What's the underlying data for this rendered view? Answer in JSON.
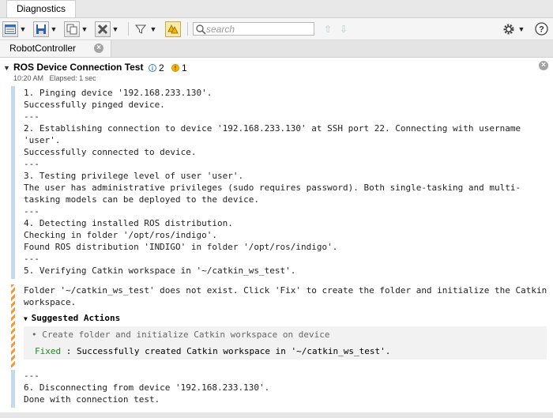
{
  "window": {
    "main_tab": "Diagnostics"
  },
  "toolbar": {
    "search_placeholder": "search",
    "icons": [
      "view-list-icon",
      "save-icon",
      "copy-icon",
      "clear-icon",
      "filter-icon",
      "warning-filter-icon",
      "up-arrow-icon",
      "down-arrow-icon",
      "gear-icon",
      "help-icon"
    ]
  },
  "sub_tab": {
    "label": "RobotController"
  },
  "section": {
    "title": "ROS Device Connection Test",
    "info_count": "2",
    "warning_count": "1",
    "time": "10:20 AM",
    "elapsed": "Elapsed: 1 sec"
  },
  "log": {
    "block1": [
      "1. Pinging device '192.168.233.130'.",
      "Successfully pinged device.",
      "---",
      "2. Establishing connection to device '192.168.233.130' at SSH port 22. Connecting with username",
      "'user'.",
      "Successfully connected to device.",
      "---",
      "3. Testing privilege level of user 'user'.",
      "The user has administrative privileges (sudo requires password). Both single-tasking and multi-",
      "tasking models can be deployed to the device.",
      "---",
      "4. Detecting installed ROS distribution.",
      "Checking in folder '/opt/ros/indigo'.",
      "Found ROS distribution 'INDIGO' in folder '/opt/ros/indigo'.",
      "---",
      "5. Verifying Catkin workspace in '~/catkin_ws_test'."
    ],
    "warning": [
      "Folder '~/catkin_ws_test' does not exist. Click 'Fix' to create the folder and initialize the Catkin",
      "workspace."
    ],
    "suggested_actions_title": "Suggested Actions",
    "suggested_action": "Create folder and initialize Catkin workspace on device",
    "fixed_label": "Fixed",
    "fixed_message": " : Successfully created Catkin workspace in '~/catkin_ws_test'.",
    "block3": [
      "---",
      "6. Disconnecting from device '192.168.233.130'.",
      "Done with connection test."
    ]
  },
  "colors": {
    "info_bar": "#c5d9ec",
    "warning_stripe": "#f29a3a",
    "fixed_green": "#1f8a1f"
  }
}
